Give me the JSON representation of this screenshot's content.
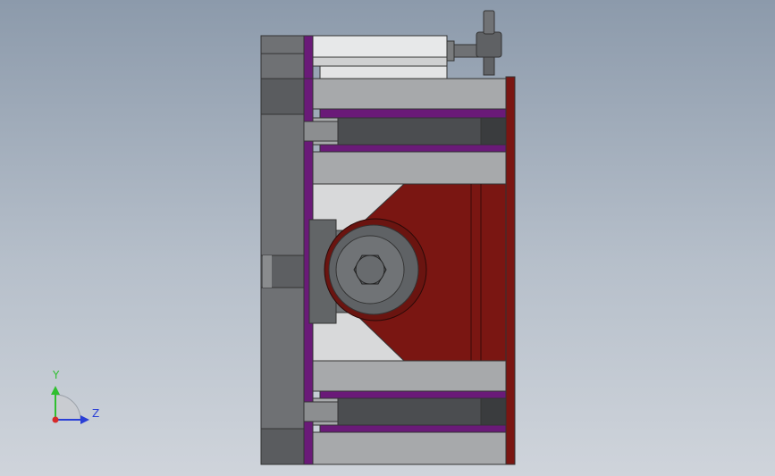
{
  "view": {
    "background_top": "#8c9aab",
    "background_bottom": "#cfd4db"
  },
  "triad": {
    "y_label": "Y",
    "z_label": "Z",
    "y_color": "#2fbf2f",
    "z_color": "#2a3fd6",
    "x_color": "#d62a2a"
  },
  "model": {
    "colors": {
      "plate": "#6f7174",
      "plate_dark": "#4f5154",
      "body": "#a7a9ab",
      "body_light": "#d8d9da",
      "purple": "#6a1a78",
      "red": "#7a1612",
      "rod": "#54575a",
      "roller": "#66696c"
    }
  }
}
